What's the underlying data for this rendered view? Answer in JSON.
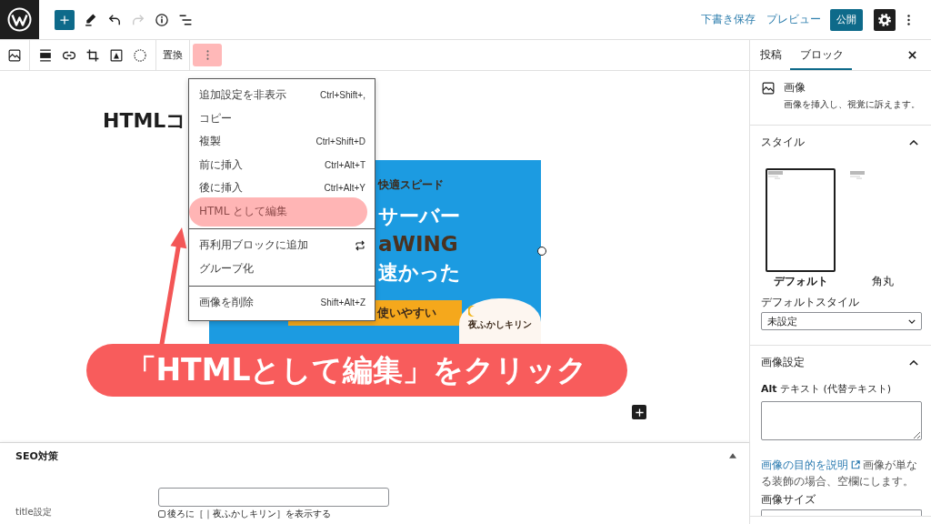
{
  "top_bar": {
    "tools": [
      {
        "kind": "add",
        "disabled": false
      },
      {
        "kind": "edit",
        "disabled": false
      },
      {
        "kind": "undo",
        "disabled": false
      },
      {
        "kind": "redo",
        "disabled": true
      },
      {
        "kind": "info",
        "disabled": false
      },
      {
        "kind": "outline",
        "disabled": false
      }
    ],
    "save_draft": "下書き保存",
    "preview": "プレビュー",
    "publish": "公開",
    "settings_pressed": true
  },
  "block_toolbar": {
    "groups": [
      [
        {
          "kind": "image"
        }
      ],
      [
        {
          "kind": "align"
        },
        {
          "kind": "link"
        },
        {
          "kind": "crop"
        },
        {
          "kind": "text_overlay"
        },
        {
          "kind": "select"
        }
      ]
    ],
    "replace": "置換",
    "more_highlighted": true
  },
  "editor": {
    "heading": "HTMLコ",
    "image": {
      "lines": [
        {
          "kind": "tagline",
          "text": "快適スピード"
        },
        {
          "kind": "headline",
          "text": "サーバー"
        },
        {
          "kind": "brand",
          "text": "aWING"
        },
        {
          "kind": "headline",
          "text": "速かった"
        }
      ],
      "badge": "使いやすい",
      "logo": "夜ふかしキリン"
    }
  },
  "menu": {
    "groups": [
      [
        {
          "kind": "shortcut",
          "label": "追加設定を非表示",
          "shortcut": "Ctrl+Shift+,",
          "highlighted": false
        },
        {
          "kind": "plain",
          "label": "コピー",
          "highlighted": false
        },
        {
          "kind": "shortcut",
          "label": "複製",
          "shortcut": "Ctrl+Shift+D",
          "highlighted": false
        },
        {
          "kind": "shortcut",
          "label": "前に挿入",
          "shortcut": "Ctrl+Alt+T",
          "highlighted": false
        },
        {
          "kind": "shortcut",
          "label": "後に挿入",
          "shortcut": "Ctrl+Alt+Y",
          "highlighted": false
        },
        {
          "kind": "plain",
          "label": "HTML として編集",
          "highlighted": true
        }
      ],
      [
        {
          "kind": "icon",
          "label": "再利用ブロックに追加",
          "highlighted": false
        },
        {
          "kind": "plain",
          "label": "グループ化",
          "highlighted": false
        }
      ],
      [
        {
          "kind": "shortcut",
          "label": "画像を削除",
          "shortcut": "Shift+Alt+Z",
          "highlighted": false
        }
      ]
    ]
  },
  "annotation": {
    "callout": "「HTMLとして編集」をクリック"
  },
  "metabox": {
    "title": "SEO対策",
    "expanded": true,
    "fields": [
      {
        "label": "title設定",
        "option": {
          "label": "後ろに［｜夜ふかしキリン］を表示する",
          "checked": false
        }
      }
    ]
  },
  "sidebar": {
    "tabs": [
      {
        "label": "投稿",
        "selected": false
      },
      {
        "label": "ブロック",
        "selected": true
      }
    ],
    "block": {
      "title": "画像",
      "description": "画像を挿入し、視覚に訴えます。"
    },
    "styles": {
      "title": "スタイル",
      "expanded": true,
      "options": [
        {
          "label": "デフォルト",
          "selected": true
        },
        {
          "label": "角丸",
          "selected": false
        }
      ],
      "default_label": "デフォルトスタイル",
      "default_value": "未設定"
    },
    "image_settings": {
      "title": "画像設定",
      "expanded": true,
      "alt_label": "**Alt** テキスト (代替テキスト)",
      "help_link": "画像の目的を説明",
      "help_text": "画像が単なる装飾の場合、空欄にします。",
      "size_label": "画像サイズ"
    }
  }
}
